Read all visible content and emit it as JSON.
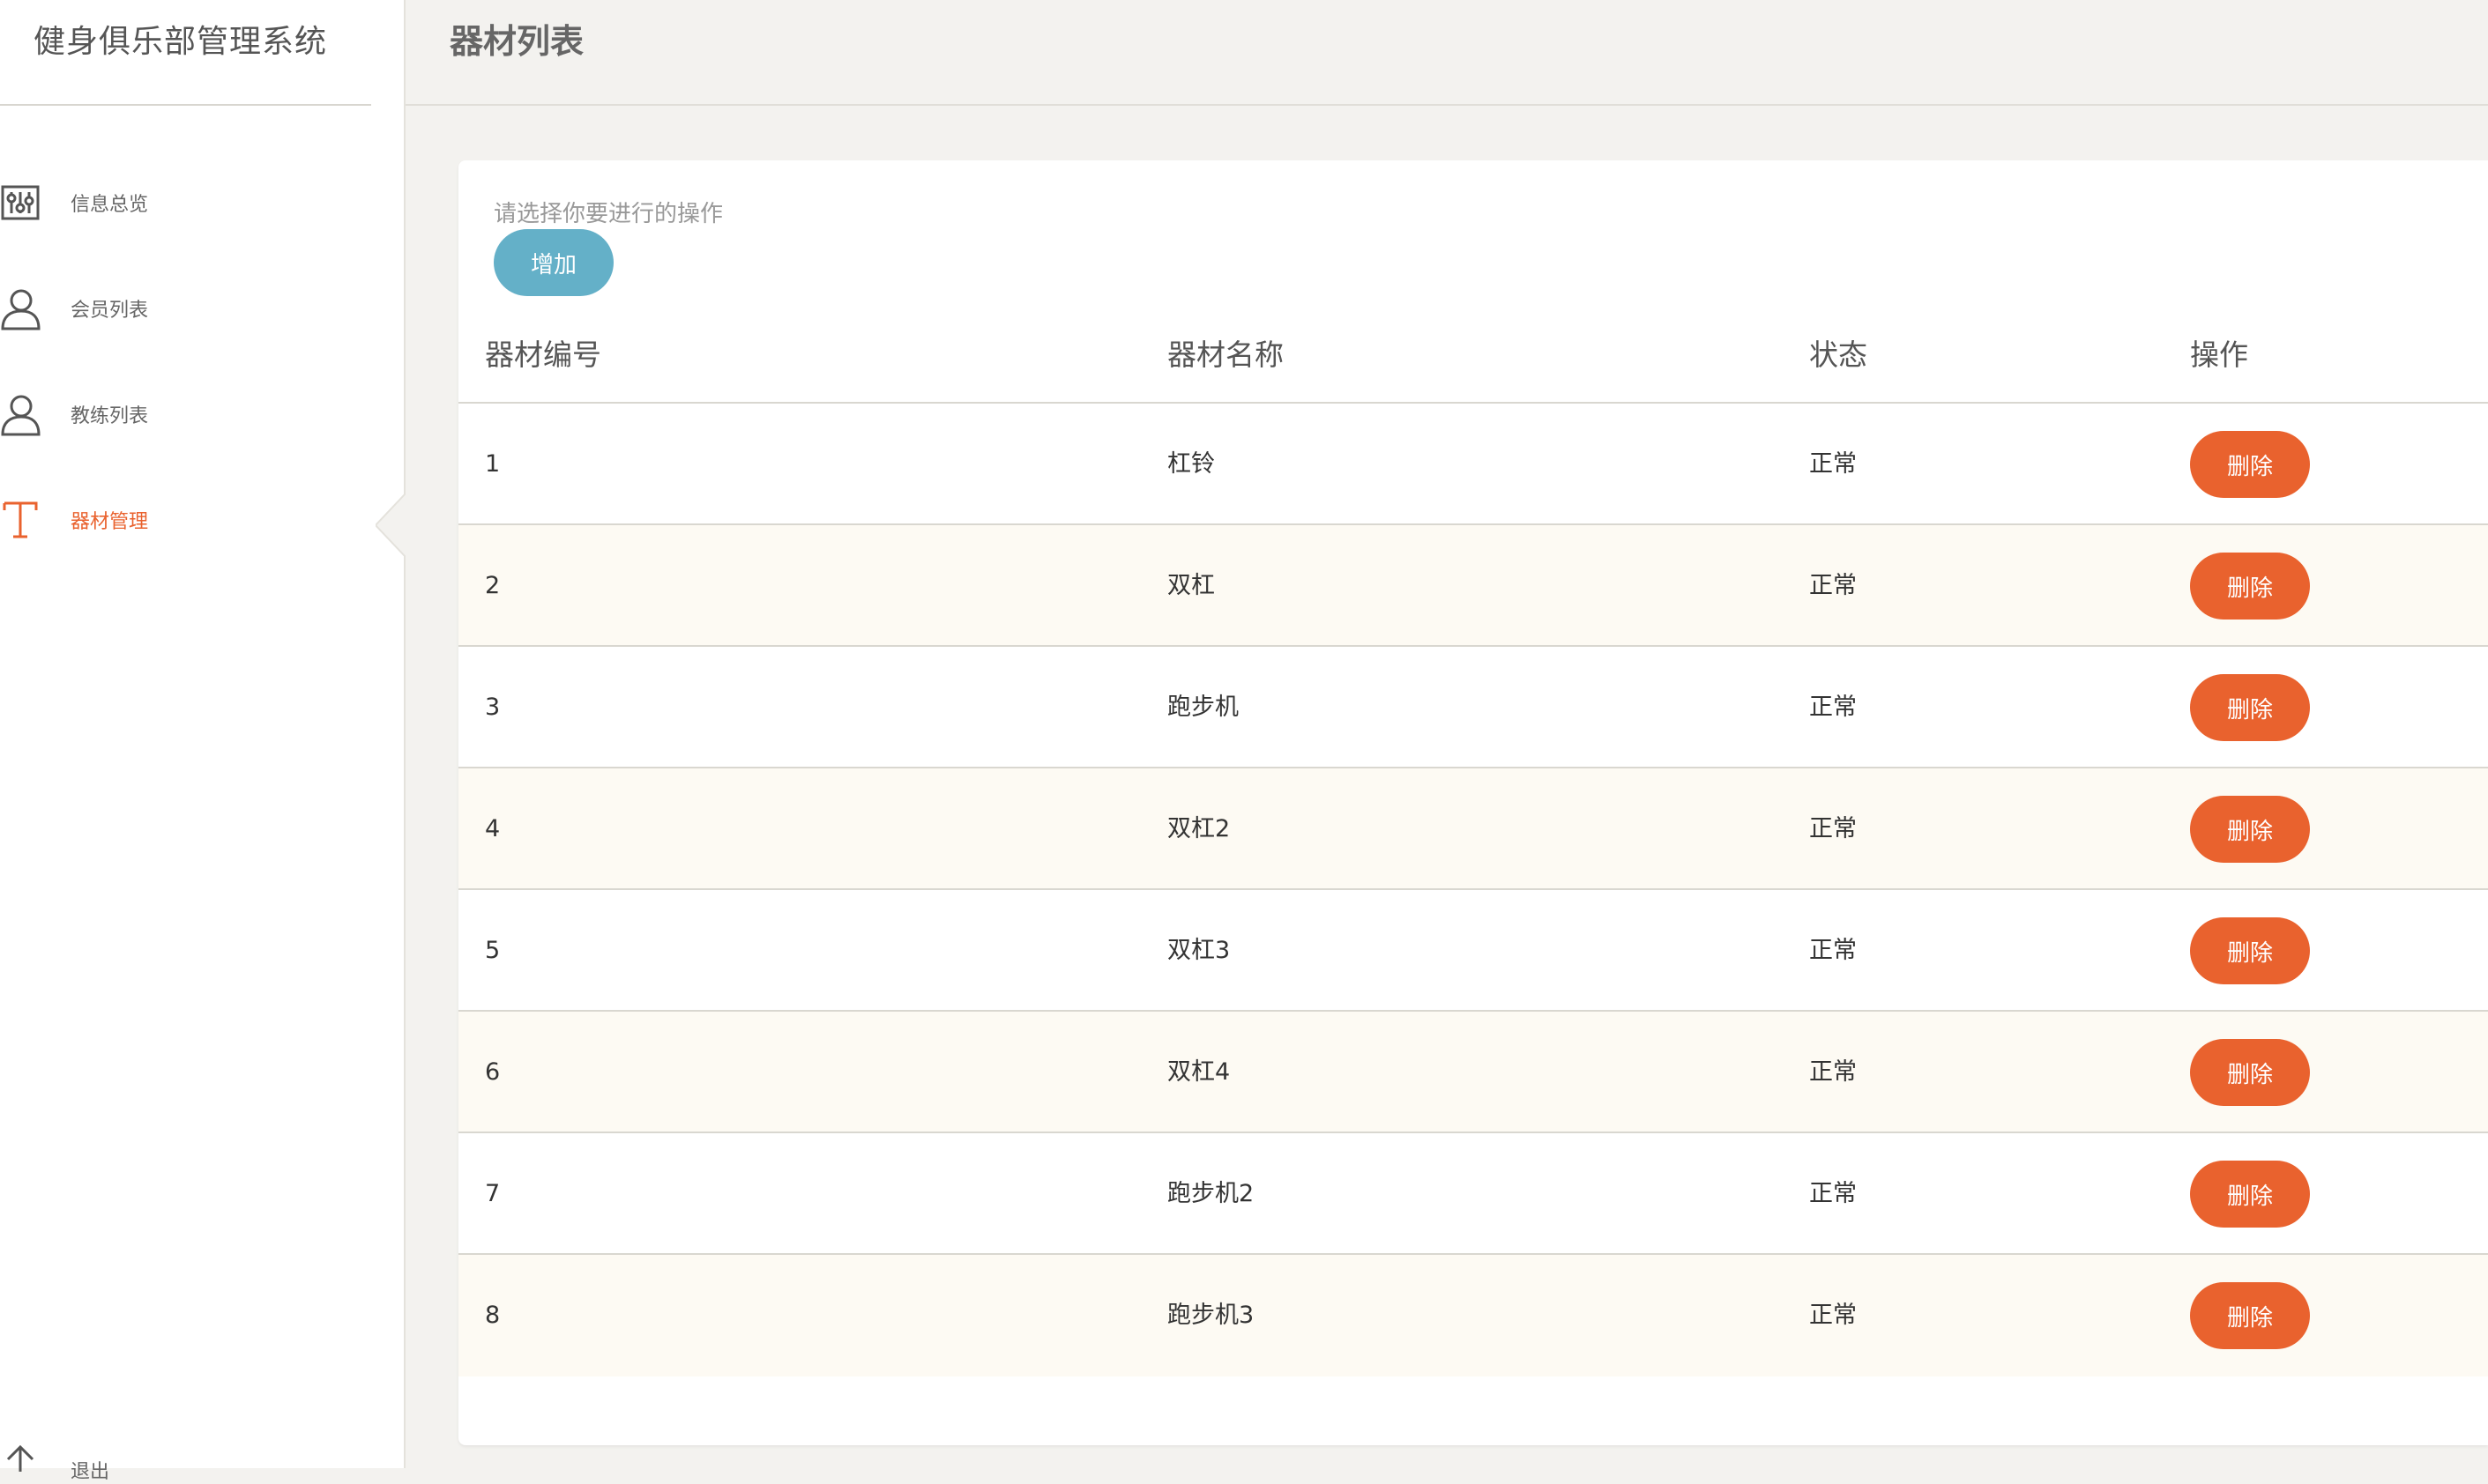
{
  "app": {
    "title": "健身俱乐部管理系统"
  },
  "sidebar": {
    "items": [
      {
        "label": "信息总览",
        "icon": "sliders-icon",
        "active": false
      },
      {
        "label": "会员列表",
        "icon": "user-icon",
        "active": false
      },
      {
        "label": "教练列表",
        "icon": "user-icon",
        "active": false
      },
      {
        "label": "器材管理",
        "icon": "text-t-icon",
        "active": true
      }
    ],
    "logout": {
      "label": "退出",
      "icon": "upload-arrow-icon"
    }
  },
  "header": {
    "title": "器材列表"
  },
  "panel": {
    "hint": "请选择你要进行的操作",
    "add_label": "增加"
  },
  "table": {
    "columns": [
      "器材编号",
      "器材名称",
      "状态",
      "操作"
    ],
    "rows": [
      {
        "id": "1",
        "name": "杠铃",
        "status": "正常",
        "action": "删除"
      },
      {
        "id": "2",
        "name": "双杠",
        "status": "正常",
        "action": "删除"
      },
      {
        "id": "3",
        "name": "跑步机",
        "status": "正常",
        "action": "删除"
      },
      {
        "id": "4",
        "name": "双杠2",
        "status": "正常",
        "action": "删除"
      },
      {
        "id": "5",
        "name": "双杠3",
        "status": "正常",
        "action": "删除"
      },
      {
        "id": "6",
        "name": "双杠4",
        "status": "正常",
        "action": "删除"
      },
      {
        "id": "7",
        "name": "跑步机2",
        "status": "正常",
        "action": "删除"
      },
      {
        "id": "8",
        "name": "跑步机3",
        "status": "正常",
        "action": "删除"
      }
    ]
  },
  "colors": {
    "accent": "#e9622e",
    "add_button": "#64b0c8",
    "background": "#f3f2ef",
    "alt_row": "#fdfaf3"
  }
}
